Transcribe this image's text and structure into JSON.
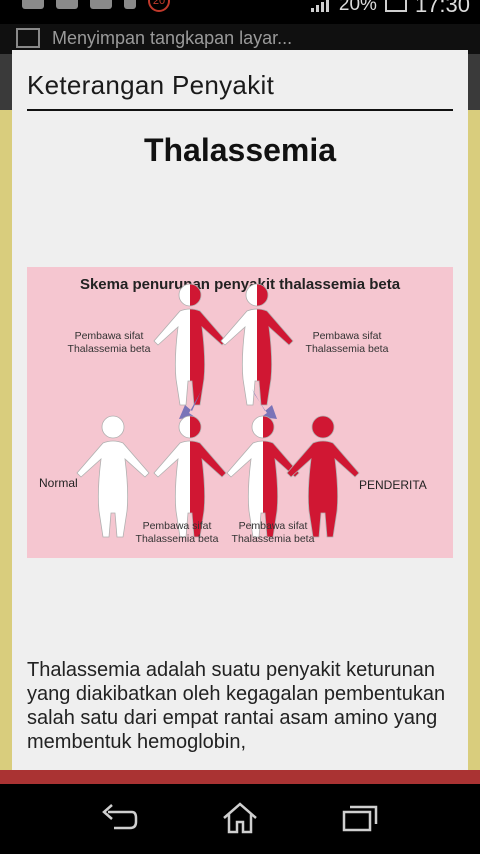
{
  "status_bar": {
    "battery": "20%",
    "time": "17:30",
    "notification_badge": "20"
  },
  "notification": {
    "text": "Menyimpan tangkapan layar..."
  },
  "dialog": {
    "title": "Keterangan Penyakit",
    "disease_name": "Thalassemia",
    "description": "Thalassemia adalah suatu  penyakit keturunan yang diakibatkan oleh kegagalan pembentukan salah satu  dari empat rantai asam amino yang membentuk hemoglobin,"
  },
  "diagram": {
    "title": "Skema penurunan penyakit thalassemia beta",
    "parent_left": [
      "Pembawa sifat",
      "Thalassemia beta"
    ],
    "parent_right": [
      "Pembawa sifat",
      "Thalassemia beta"
    ],
    "child_normal": "Normal",
    "child_carrier_1": [
      "Pembawa sifat",
      "Thalassemia beta"
    ],
    "child_carrier_2": [
      "Pembawa sifat",
      "Thalassemia beta"
    ],
    "child_sufferer": "PENDERITA",
    "colors": {
      "background": "#f5c6d0",
      "red": "#d01733",
      "white": "#ffffff",
      "arrow": "#7a74b8"
    }
  },
  "nav": {
    "back_icon": "back-icon",
    "home_icon": "home-icon",
    "recents_icon": "recents-icon"
  }
}
